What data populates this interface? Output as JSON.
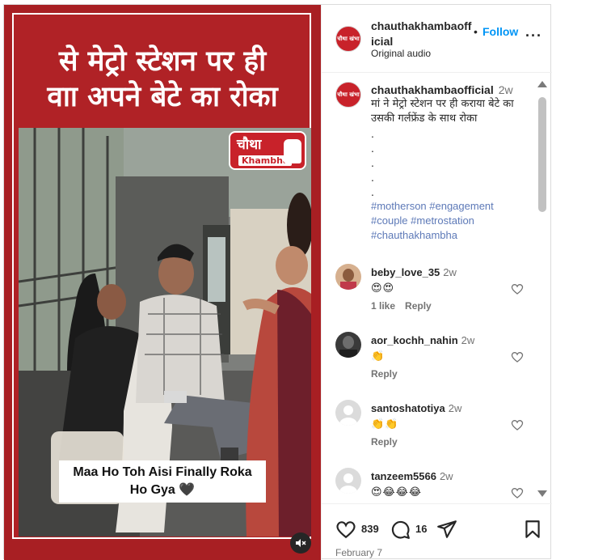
{
  "media": {
    "headline_line1": "से मेट्रो स्टेशन पर ही",
    "headline_line2": "वाा अपने बेटे का रोका",
    "brand_logo_line1": "चौथा",
    "brand_logo_line2": "Khambha",
    "video_caption_line1": "Maa Ho Toh Aisi Finally Roka",
    "video_caption_line2": "Ho Gya 🖤",
    "mute_icon": "muted-speaker-icon"
  },
  "header": {
    "username": "chauthakhambaofficial",
    "dot": "•",
    "follow_label": "Follow",
    "audio_label": "Original audio",
    "more_label": "···",
    "avatar_text": "चौथा खंभा"
  },
  "caption": {
    "username": "chauthakhambaofficial",
    "time": "2w",
    "text": "मां ने मेट्रो स्टेशन पर ही कराया बेटे का उसकी गर्लफ्रेंड के साथ रोका",
    "dots": [
      ".",
      ".",
      ".",
      ".",
      "."
    ],
    "hashtags_line1": "#motherson #engagement",
    "hashtags_line2": "#couple #metrostation",
    "hashtags_line3": "#chauthakhambha"
  },
  "comments": [
    {
      "username": "beby_love_35",
      "time": "2w",
      "text": "😍😍",
      "likes": "1 like",
      "reply": "Reply"
    },
    {
      "username": "aor_kochh_nahin",
      "time": "2w",
      "text": "👏",
      "likes": "",
      "reply": "Reply"
    },
    {
      "username": "santoshatotiya",
      "time": "2w",
      "text": "👏👏",
      "likes": "",
      "reply": "Reply"
    },
    {
      "username": "tanzeem5566",
      "time": "2w",
      "text": "😍😂😂😂",
      "likes": "",
      "reply": ""
    }
  ],
  "actions": {
    "like_count": "839",
    "comment_count": "16",
    "date": "February 7"
  },
  "colors": {
    "brand_red": "#a81f23",
    "follow_blue": "#0095f6",
    "hashtag_blue": "#3558a6"
  }
}
